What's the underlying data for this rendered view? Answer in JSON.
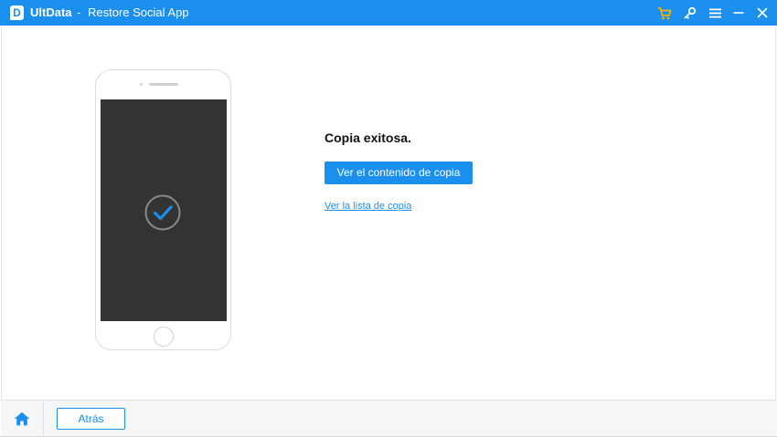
{
  "window": {
    "app_name": "UltData",
    "separator": "-",
    "subtitle": "Restore Social App",
    "logo_letter": "D"
  },
  "titlebar_icons": [
    "cart-icon",
    "key-icon",
    "menu-icon",
    "minimize-icon",
    "close-icon"
  ],
  "colors": {
    "accent": "#1b8fee",
    "cart": "#f5b400",
    "phone_screen": "#333333"
  },
  "main": {
    "title": "Copia exitosa.",
    "primary_button": "Ver el contenido de copia",
    "list_link": "Ver la lista de copia"
  },
  "footer": {
    "back_button": "Atrás"
  }
}
